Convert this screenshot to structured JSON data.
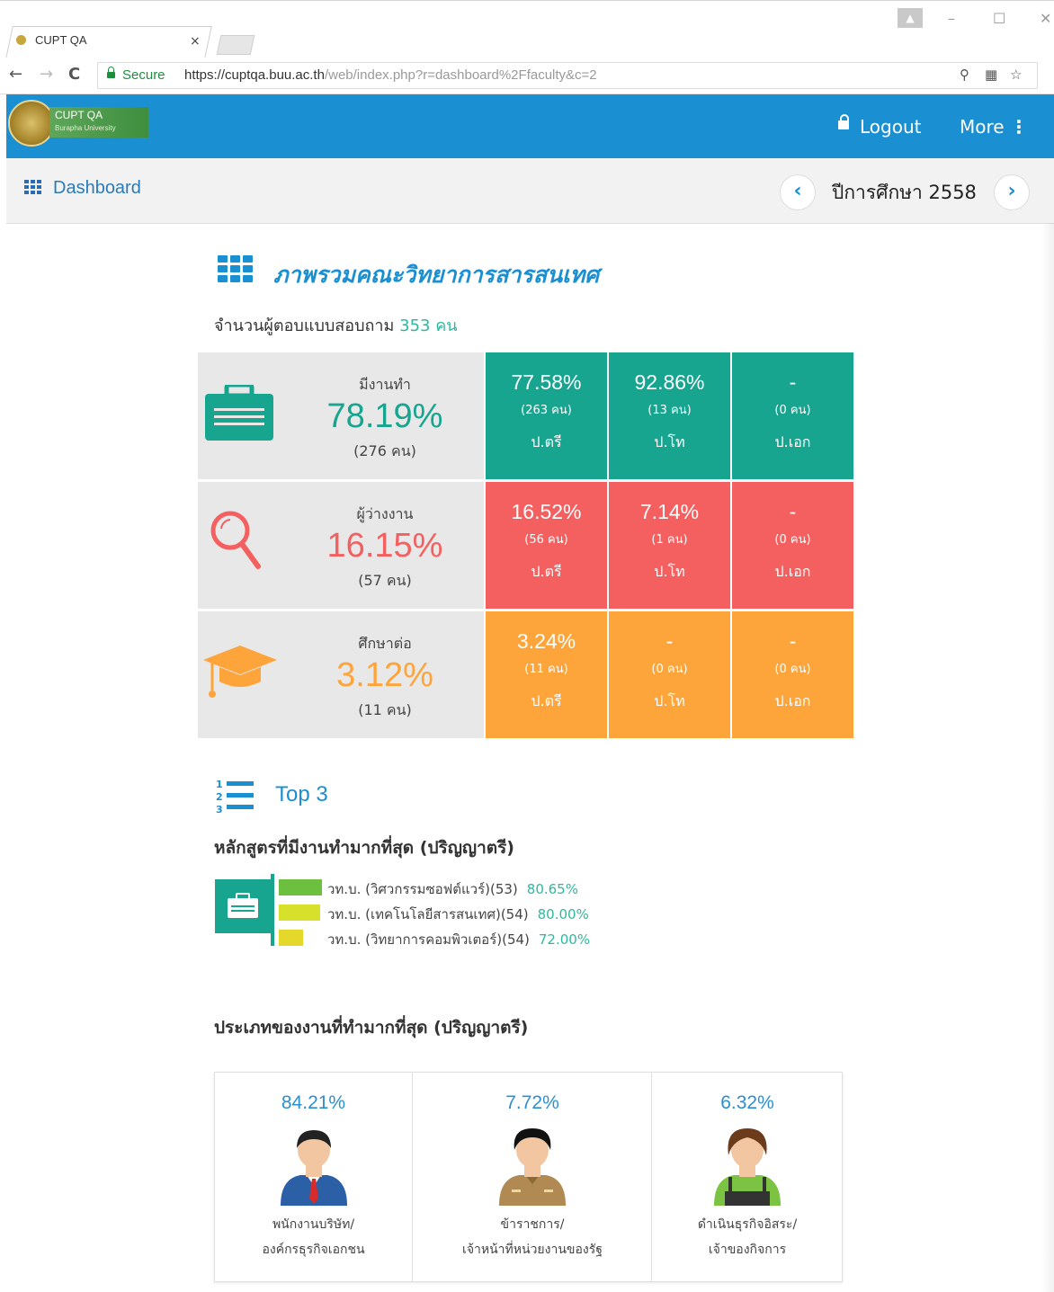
{
  "browser": {
    "tab_title": "CUPT QA",
    "tab_close": "×",
    "secure_label": "Secure",
    "url_host": "https://cuptqa.buu.ac.th",
    "url_path": "/web/index.php?r=dashboard%2Ffaculty&c=2"
  },
  "header": {
    "logo_title": "CUPT QA",
    "logo_subtitle": "Burapha University",
    "logout_label": "Logout",
    "more_label": "More"
  },
  "subbar": {
    "dashboard_label": "Dashboard",
    "prev_symbol": "‹",
    "next_symbol": "›",
    "year_label": "ปีการศึกษา 2558"
  },
  "overview": {
    "title": "ภาพรวมคณะวิทยาการสารสนเทศ",
    "respondents_label": "จำนวนผู้ตอบแบบสอบถาม",
    "respondents_value": "353 คน",
    "rows": [
      {
        "label": "มีงานทำ",
        "pct": "78.19%",
        "count": "(276 คน)",
        "color": "#17a590",
        "cells": [
          {
            "pct": "77.58%",
            "count": "(263 คน)",
            "degree": "ป.ตรี"
          },
          {
            "pct": "92.86%",
            "count": "(13 คน)",
            "degree": "ป.โท"
          },
          {
            "pct": "-",
            "count": "(0 คน)",
            "degree": "ป.เอก"
          }
        ]
      },
      {
        "label": "ผู้ว่างงาน",
        "pct": "16.15%",
        "count": "(57 คน)",
        "color": "#f45f5f",
        "cells": [
          {
            "pct": "16.52%",
            "count": "(56 คน)",
            "degree": "ป.ตรี"
          },
          {
            "pct": "7.14%",
            "count": "(1 คน)",
            "degree": "ป.โท"
          },
          {
            "pct": "-",
            "count": "(0 คน)",
            "degree": "ป.เอก"
          }
        ]
      },
      {
        "label": "ศึกษาต่อ",
        "pct": "3.12%",
        "count": "(11 คน)",
        "color": "#fda43a",
        "cells": [
          {
            "pct": "3.24%",
            "count": "(11 คน)",
            "degree": "ป.ตรี"
          },
          {
            "pct": "-",
            "count": "(0 คน)",
            "degree": "ป.โท"
          },
          {
            "pct": "-",
            "count": "(0 คน)",
            "degree": "ป.เอก"
          }
        ]
      }
    ]
  },
  "top3": {
    "title": "Top 3",
    "programs_heading": "หลักสูตรที่มีงานทำมากที่สุด (ปริญญาตรี)",
    "programs": [
      {
        "name": "วท.บ. (วิศวกรรมซอฟต์แวร์)(53)",
        "pct": "80.65%",
        "color": "#6cbf3f"
      },
      {
        "name": "วท.บ. (เทคโนโลยีสารสนเทศ)(54)",
        "pct": "80.00%",
        "color": "#d7e02b"
      },
      {
        "name": "วท.บ. (วิทยาการคอมพิวเตอร์)(54)",
        "pct": "72.00%",
        "color": "#e4d82a"
      }
    ],
    "types_heading": "ประเภทของงานที่ทำมากที่สุด (ปริญญาตรี)",
    "types": [
      {
        "pct": "84.21%",
        "line1": "พนักงานบริษัท/",
        "line2": "องค์กรธุรกิจเอกชน",
        "icon": "office-worker-icon"
      },
      {
        "pct": "7.72%",
        "line1": "ข้าราชการ/",
        "line2": "เจ้าหน้าที่หน่วยงานของรัฐ",
        "icon": "civil-servant-icon"
      },
      {
        "pct": "6.32%",
        "line1": "ดำเนินธุรกิจอิสระ/",
        "line2": "เจ้าของกิจการ",
        "icon": "business-owner-icon"
      }
    ]
  }
}
